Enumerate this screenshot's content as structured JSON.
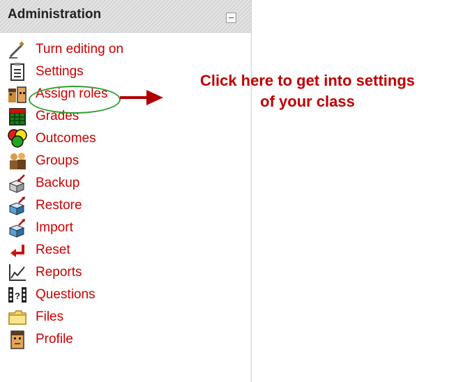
{
  "admin": {
    "title": "Administration",
    "items": [
      {
        "label": "Turn editing on",
        "icon": "edit-pen-icon"
      },
      {
        "label": "Settings",
        "icon": "settings-document-icon"
      },
      {
        "label": "Assign roles",
        "icon": "roles-faces-icon"
      },
      {
        "label": "Grades",
        "icon": "grades-grid-icon"
      },
      {
        "label": "Outcomes",
        "icon": "outcomes-circles-icon"
      },
      {
        "label": "Groups",
        "icon": "groups-people-icon"
      },
      {
        "label": "Backup",
        "icon": "backup-box-icon"
      },
      {
        "label": "Restore",
        "icon": "restore-box-icon"
      },
      {
        "label": "Import",
        "icon": "import-box-icon"
      },
      {
        "label": "Reset",
        "icon": "reset-arrow-icon"
      },
      {
        "label": "Reports",
        "icon": "reports-chart-icon"
      },
      {
        "label": "Questions",
        "icon": "questions-dots-icon"
      },
      {
        "label": "Files",
        "icon": "folder-icon"
      },
      {
        "label": "Profile",
        "icon": "profile-face-icon"
      }
    ]
  },
  "annotation": {
    "line1": "Click here to get into settings",
    "line2": "of your class"
  },
  "colors": {
    "link": "#cc0000",
    "callout": "#c00000",
    "highlight": "#2e9e2e"
  }
}
